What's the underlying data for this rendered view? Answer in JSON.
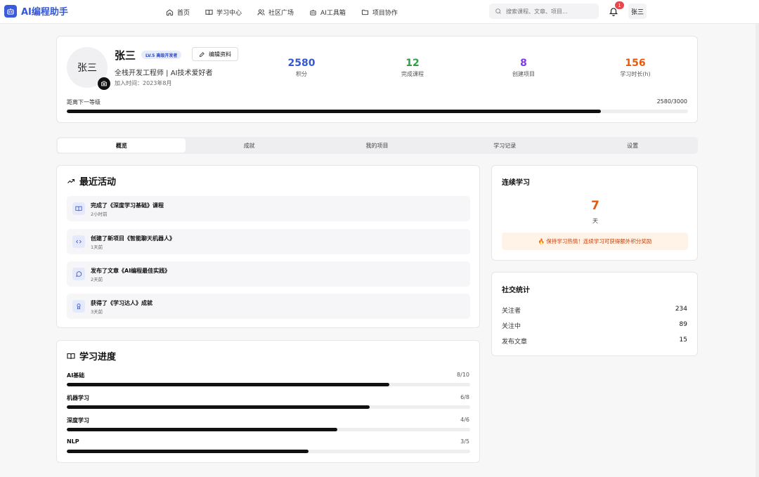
{
  "header": {
    "app_name": "AI编程助手",
    "nav": [
      {
        "label": "首页",
        "icon": "home-icon"
      },
      {
        "label": "学习中心",
        "icon": "book-icon"
      },
      {
        "label": "社区广场",
        "icon": "users-icon"
      },
      {
        "label": "AI工具箱",
        "icon": "bot-icon"
      },
      {
        "label": "项目协作",
        "icon": "folder-icon"
      }
    ],
    "search_placeholder": "搜索课程、文章、项目...",
    "notification_count": "1",
    "user_name": "张三"
  },
  "profile": {
    "avatar_text": "张三",
    "name": "张三",
    "level_badge": "LV.5 高级开发者",
    "edit_label": "编辑资料",
    "description": "全栈开发工程师 | AI技术爱好者",
    "joined": "加入时间：2023年8月",
    "stats": [
      {
        "value": "2580",
        "label": "积分",
        "color": "#3457d5"
      },
      {
        "value": "12",
        "label": "完成课程",
        "color": "#2f9e44"
      },
      {
        "value": "8",
        "label": "创建项目",
        "color": "#7c3aed"
      },
      {
        "value": "156",
        "label": "学习时长(h)",
        "color": "#e8590c"
      }
    ],
    "next_level_label": "距离下一等级",
    "next_level_count": "2580/3000",
    "next_level_fraction": 0.86
  },
  "tabs": [
    "概览",
    "成就",
    "我的项目",
    "学习记录",
    "设置"
  ],
  "activity": {
    "title": "最近活动",
    "items": [
      {
        "title": "完成了《深度学习基础》课程",
        "time": "2小时前",
        "icon": "book-icon"
      },
      {
        "title": "创建了新项目《智能聊天机器人》",
        "time": "1天前",
        "icon": "code-icon"
      },
      {
        "title": "发布了文章《AI编程最佳实践》",
        "time": "2天前",
        "icon": "message-icon"
      },
      {
        "title": "获得了《学习达人》成就",
        "time": "3天前",
        "icon": "award-icon"
      }
    ]
  },
  "learning": {
    "title": "学习进度",
    "rows": [
      {
        "name": "AI基础",
        "value": "8/10",
        "fraction": 0.8
      },
      {
        "name": "机器学习",
        "value": "6/8",
        "fraction": 0.75
      },
      {
        "name": "深度学习",
        "value": "4/6",
        "fraction": 0.67
      },
      {
        "name": "NLP",
        "value": "3/5",
        "fraction": 0.6
      }
    ]
  },
  "streak": {
    "title": "连续学习",
    "days": "7",
    "unit": "天",
    "tip": "🔥 保持学习热情！连续学习可获得额外积分奖励"
  },
  "social": {
    "title": "社交统计",
    "rows": [
      {
        "label": "关注者",
        "value": "234"
      },
      {
        "label": "关注中",
        "value": "89"
      },
      {
        "label": "发布文章",
        "value": "15"
      }
    ]
  }
}
